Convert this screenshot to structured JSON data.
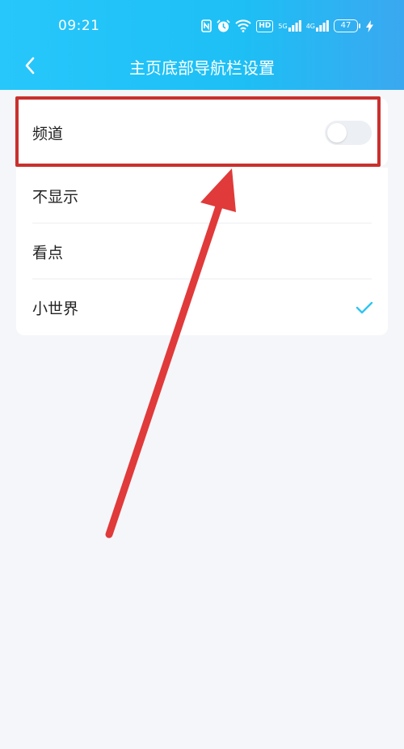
{
  "status_bar": {
    "time": "09:21",
    "hd_label": "HD",
    "signal1_label": "5G",
    "signal2_label": "4G",
    "battery_level": "47",
    "icons": [
      "nfc-icon",
      "alarm-icon",
      "wifi-icon",
      "hd-icon",
      "signal-icon",
      "signal-icon",
      "battery-icon",
      "charging-icon"
    ]
  },
  "nav": {
    "back_icon": "chevron-left-icon",
    "title": "主页底部导航栏设置"
  },
  "settings": {
    "channel": {
      "label": "频道",
      "toggle_on": false
    },
    "options": [
      {
        "label": "不显示",
        "selected": false
      },
      {
        "label": "看点",
        "selected": false
      },
      {
        "label": "小世界",
        "selected": true
      }
    ]
  },
  "colors": {
    "header": "#1dbff5",
    "accent_check": "#2ec5f2",
    "annotation": "#d9322f"
  }
}
